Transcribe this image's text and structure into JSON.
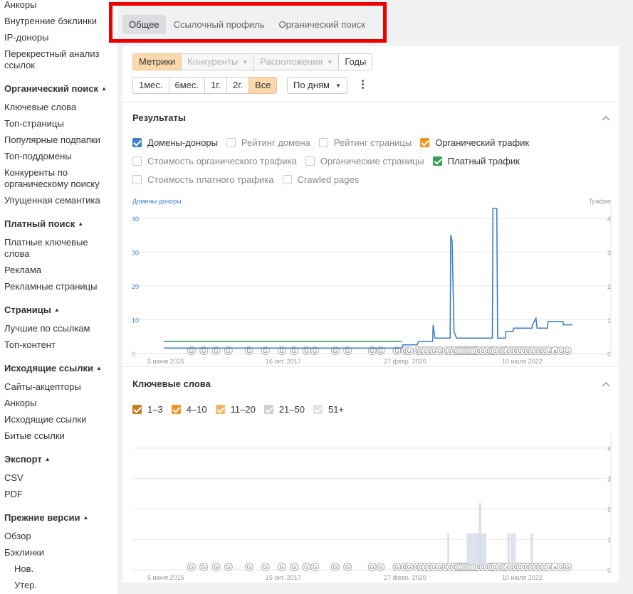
{
  "sidebar": {
    "items": [
      {
        "type": "item",
        "label": "Анкоры"
      },
      {
        "type": "item",
        "label": "Внутренние бэклинки"
      },
      {
        "type": "item",
        "label": "IP-доноры"
      },
      {
        "type": "item",
        "label": "Перекрестный анализ ссылок"
      },
      {
        "type": "head",
        "label": "Органический поиск"
      },
      {
        "type": "item",
        "label": "Ключевые слова"
      },
      {
        "type": "item",
        "label": "Топ-страницы"
      },
      {
        "type": "item",
        "label": "Популярные подпапки"
      },
      {
        "type": "item",
        "label": "Топ-поддомены"
      },
      {
        "type": "item",
        "label": "Конкуренты по органическому поиску"
      },
      {
        "type": "item",
        "label": "Упущенная семантика"
      },
      {
        "type": "head",
        "label": "Платный поиск"
      },
      {
        "type": "item",
        "label": "Платные ключевые слова"
      },
      {
        "type": "item",
        "label": "Реклама"
      },
      {
        "type": "item",
        "label": "Рекламные страницы"
      },
      {
        "type": "head",
        "label": "Страницы"
      },
      {
        "type": "item",
        "label": "Лучшие по ссылкам"
      },
      {
        "type": "item",
        "label": "Топ-контент"
      },
      {
        "type": "head",
        "label": "Исходящие ссылки"
      },
      {
        "type": "item",
        "label": "Сайты-акцепторы"
      },
      {
        "type": "item",
        "label": "Анкоры"
      },
      {
        "type": "item",
        "label": "Исходящие ссылки"
      },
      {
        "type": "item",
        "label": "Битые ссылки"
      },
      {
        "type": "head",
        "label": "Экспорт"
      },
      {
        "type": "item",
        "label": "CSV"
      },
      {
        "type": "item",
        "label": "PDF"
      },
      {
        "type": "head",
        "label": "Прежние версии"
      },
      {
        "type": "item",
        "label": "Обзор"
      },
      {
        "type": "item",
        "label": "Бэклинки"
      },
      {
        "type": "sub",
        "label": "Нов."
      },
      {
        "type": "sub",
        "label": "Утер."
      }
    ],
    "head_marker": "▲"
  },
  "tabs": [
    {
      "label": "Общее",
      "active": true
    },
    {
      "label": "Ссылочный профиль",
      "active": false
    },
    {
      "label": "Органический поиск",
      "active": false
    }
  ],
  "toolbar": {
    "view_buttons": [
      {
        "label": "Метрики",
        "state": "on",
        "caret": false
      },
      {
        "label": "Конкуренты",
        "state": "dis",
        "caret": true
      },
      {
        "label": "Расположения",
        "state": "dis",
        "caret": true
      },
      {
        "label": "Годы",
        "state": "normal",
        "caret": false
      }
    ],
    "period_buttons": [
      {
        "label": "1мес.",
        "state": "normal"
      },
      {
        "label": "6мес.",
        "state": "normal"
      },
      {
        "label": "1г.",
        "state": "normal"
      },
      {
        "label": "2г.",
        "state": "normal"
      },
      {
        "label": "Все",
        "state": "on"
      }
    ],
    "granularity_label": "По дням",
    "caret": "▼"
  },
  "results": {
    "title": "Результаты",
    "checkbox_rows": [
      [
        {
          "label": "Домены-доноры",
          "checked": true,
          "color": "#3f80c7"
        },
        {
          "label": "Рейтинг домена",
          "checked": false
        },
        {
          "label": "Рейтинг страницы",
          "checked": false
        },
        {
          "label": "Органический трафик",
          "checked": true,
          "color": "#f0961e"
        }
      ],
      [
        {
          "label": "Стоимость органического трафика",
          "checked": false
        },
        {
          "label": "Органические страницы",
          "checked": false
        },
        {
          "label": "Платный трафик",
          "checked": true,
          "color": "#35a05a"
        }
      ],
      [
        {
          "label": "Стоимость платного трафика",
          "checked": false
        },
        {
          "label": "Crawled pages",
          "checked": false
        }
      ]
    ]
  },
  "keywords": {
    "title": "Ключевые слова",
    "checkboxes": [
      {
        "label": "1–3",
        "checked": true,
        "color": "#c77d1a"
      },
      {
        "label": "4–10",
        "checked": true,
        "color": "#f0961e"
      },
      {
        "label": "11–20",
        "checked": true,
        "color": "#f3b768"
      },
      {
        "label": "21–50",
        "checked": true,
        "color": "#cfcfcf"
      },
      {
        "label": "51+",
        "checked": true,
        "color": "#e1e1e1"
      }
    ]
  },
  "chart_data": [
    {
      "type": "line",
      "title": "",
      "ylabel_left": "Домены-доноры",
      "ylabel_right": "Трафик",
      "left_ticks": [
        "0",
        "10",
        "20",
        "30",
        "40"
      ],
      "right_ticks": [
        "0",
        "1",
        "2",
        "3",
        "4"
      ],
      "x_ticks": [
        "5 июня 2015",
        "16 окт. 2017",
        "27 февр. 2020",
        "10 июля 2022"
      ],
      "x_range": [
        "2015-03-01",
        "2024-03-01"
      ],
      "ylim_left": [
        0,
        43
      ],
      "ylim_right": [
        0,
        4.3
      ],
      "series": [
        {
          "name": "Домены-доноры",
          "color": "#3f80c7",
          "points": [
            [
              "2015-03-01",
              1
            ],
            [
              "2020-05-01",
              1
            ],
            [
              "2020-05-10",
              2
            ],
            [
              "2020-09-01",
              2
            ],
            [
              "2020-09-10",
              3
            ],
            [
              "2021-01-01",
              3
            ],
            [
              "2021-01-05",
              8
            ],
            [
              "2021-01-20",
              4
            ],
            [
              "2021-05-20",
              4
            ],
            [
              "2021-05-25",
              35
            ],
            [
              "2021-06-05",
              33
            ],
            [
              "2021-06-20",
              6
            ],
            [
              "2021-07-10",
              4
            ],
            [
              "2022-04-20",
              4
            ],
            [
              "2022-04-25",
              43
            ],
            [
              "2022-05-25",
              43
            ],
            [
              "2022-06-01",
              4
            ],
            [
              "2022-08-01",
              4
            ],
            [
              "2022-08-05",
              6
            ],
            [
              "2022-10-01",
              6
            ],
            [
              "2022-10-05",
              7
            ],
            [
              "2023-03-01",
              7
            ],
            [
              "2023-03-05",
              8
            ],
            [
              "2023-04-01",
              10
            ],
            [
              "2023-04-10",
              7
            ],
            [
              "2023-07-01",
              7
            ],
            [
              "2023-07-05",
              9
            ],
            [
              "2023-11-01",
              9
            ],
            [
              "2023-11-05",
              8
            ],
            [
              "2024-01-15",
              8
            ]
          ]
        },
        {
          "name": "Платный трафик",
          "color": "#35a05a",
          "points": [
            [
              "2015-03-01",
              0.3
            ],
            [
              "2020-05-01",
              0.3
            ]
          ]
        }
      ],
      "annotation_marks": [
        "G",
        "G",
        "G",
        "G",
        "G",
        "G",
        "G",
        "G",
        "G",
        "G",
        "G",
        "G",
        "G",
        "G",
        "G",
        "G",
        "G",
        "G",
        "G",
        "G",
        "G",
        "G",
        "G",
        "G",
        "G",
        "G",
        "G",
        "G",
        "G",
        "G",
        "G",
        "G",
        "G",
        "G",
        "G",
        "G",
        "G",
        "G",
        "G",
        "G",
        "G",
        "G",
        "G",
        "G",
        "G",
        "a",
        "G",
        "G",
        "G",
        "G",
        "G",
        "G",
        "G",
        "G",
        "G",
        "G",
        "a",
        "G",
        "G"
      ]
    },
    {
      "type": "bar",
      "title": "",
      "ylabel_right": "",
      "right_ticks": [
        "0",
        "1",
        "2",
        "3",
        "4"
      ],
      "x_ticks": [
        "5 июня 2015",
        "16 окт. 2017",
        "27 февр. 2020",
        "10 июля 2022"
      ],
      "x_range": [
        "2015-03-01",
        "2024-03-01"
      ],
      "ylim": [
        0,
        4.3
      ],
      "series": [
        {
          "name": "51+",
          "color": "#dde3ee",
          "bars": [
            [
              "2021-05-01",
              "2021-05-10",
              1
            ],
            [
              "2021-10-01",
              "2022-01-05",
              1
            ],
            [
              "2022-01-05",
              "2022-01-20",
              2
            ],
            [
              "2022-01-20",
              "2022-03-01",
              1
            ],
            [
              "2022-08-20",
              "2022-09-01",
              1
            ],
            [
              "2022-09-15",
              "2022-10-20",
              1
            ],
            [
              "2023-02-20",
              "2023-03-05",
              1
            ]
          ]
        }
      ],
      "annotation_marks": [
        "G",
        "G",
        "G",
        "G",
        "G",
        "G",
        "G",
        "G",
        "G",
        "G",
        "G",
        "G",
        "G",
        "G",
        "G",
        "G",
        "G",
        "G",
        "G",
        "G",
        "G",
        "G",
        "G",
        "G",
        "G",
        "G",
        "G",
        "G",
        "G",
        "G",
        "G",
        "G",
        "G",
        "G",
        "G",
        "G",
        "G",
        "G",
        "G",
        "G",
        "G",
        "G",
        "G",
        "G",
        "G",
        "a",
        "G",
        "G",
        "G",
        "G",
        "G",
        "G",
        "G",
        "G",
        "G",
        "G",
        "a",
        "G",
        "G"
      ]
    }
  ]
}
